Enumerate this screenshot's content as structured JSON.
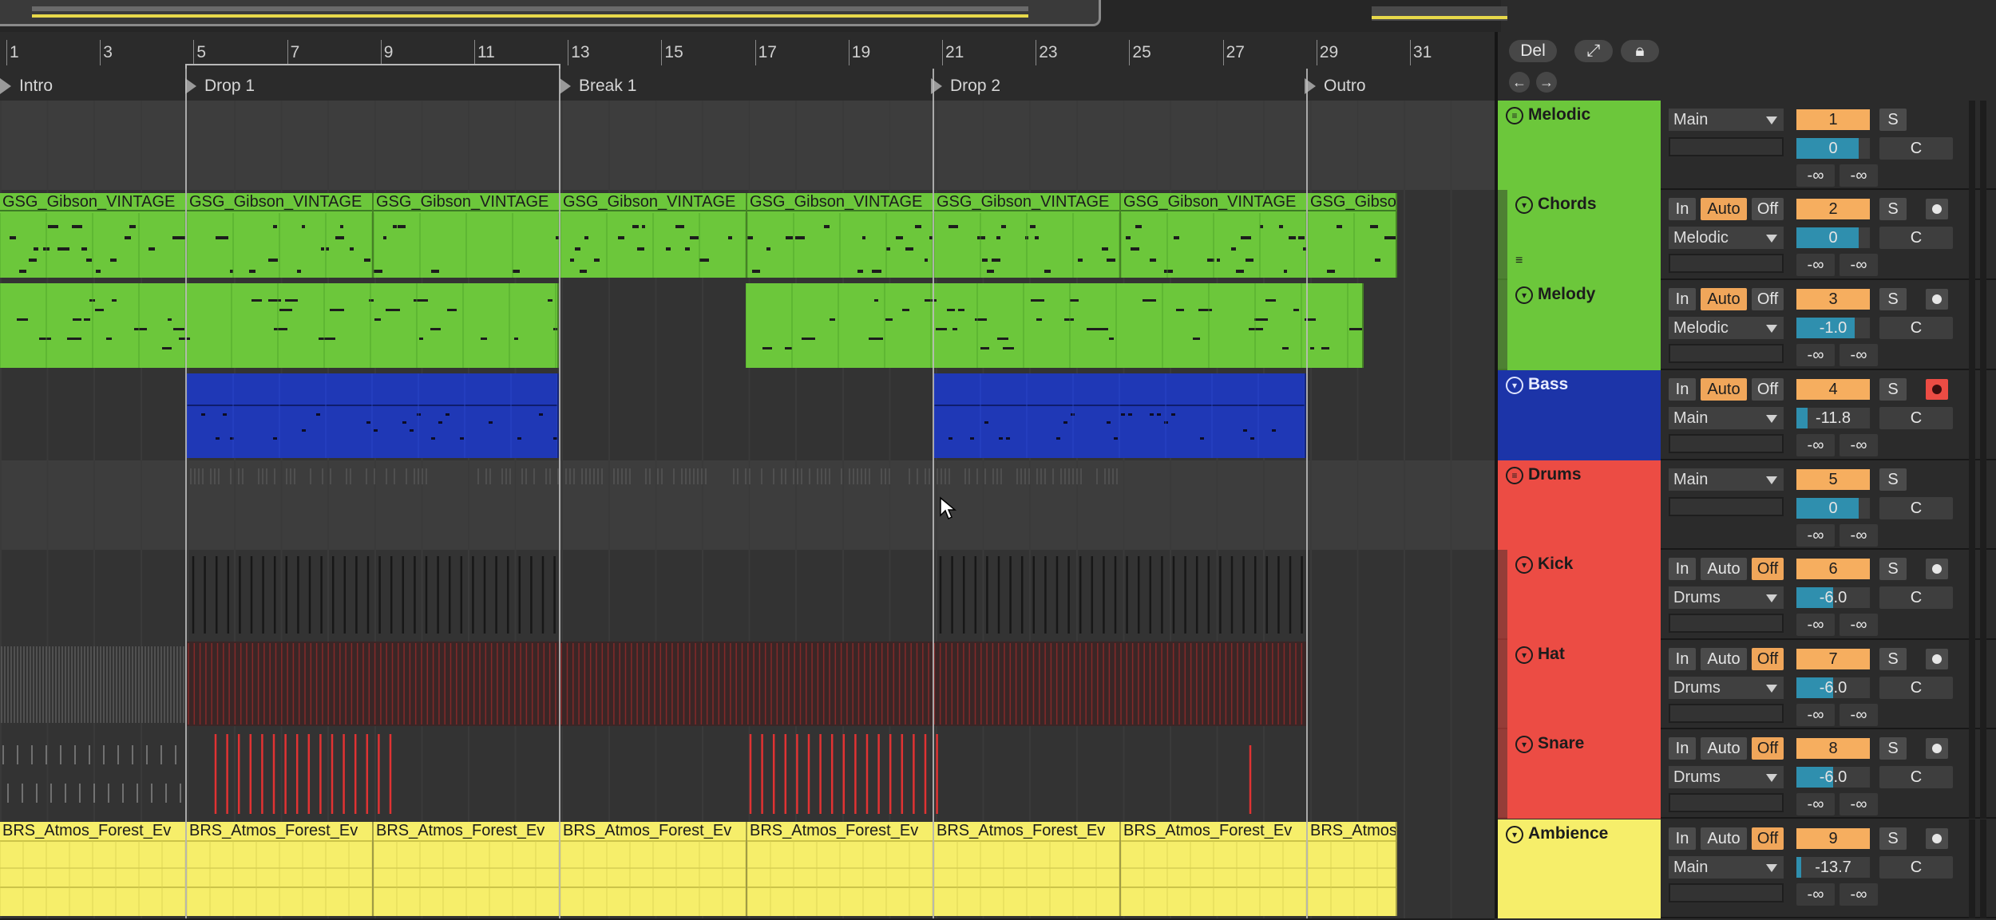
{
  "ruler": {
    "bars": [
      "1",
      "3",
      "5",
      "7",
      "9",
      "11",
      "13",
      "15",
      "17",
      "19",
      "21",
      "23",
      "25",
      "27",
      "29",
      "31"
    ]
  },
  "locators": [
    "Intro",
    "Drop 1",
    "Break 1",
    "Drop 2",
    "Outro"
  ],
  "clips": {
    "melodic_name": "GSG_Gibson_VINTAGE",
    "melodic_last": "GSG_Gibso",
    "ambience_name": "BRS_Atmos_Forest_Ev",
    "ambience_last": "BRS_Atmos"
  },
  "header": {
    "del_label": "Del",
    "expand_icon": "expand-icon",
    "lock_icon": "lock-icon",
    "back_icon": "arrow-left-icon",
    "forward_icon": "arrow-right-icon"
  },
  "tracks": [
    {
      "name": "Melodic",
      "color": "#6cc73b",
      "group": true,
      "routing": "Main",
      "number": "1",
      "solo": "S",
      "volume": "0",
      "pan": "C",
      "send_a": "-∞",
      "send_b": "-∞"
    },
    {
      "name": "Chords",
      "color": "#6cc73b",
      "in": "In",
      "auto": "Auto",
      "off": "Off",
      "routing": "Melodic",
      "number": "2",
      "solo": "S",
      "volume": "0",
      "pan": "C",
      "send_a": "-∞",
      "send_b": "-∞"
    },
    {
      "name": "Melody",
      "color": "#6cc73b",
      "in": "In",
      "auto": "Auto",
      "off": "Off",
      "routing": "Melodic",
      "number": "3",
      "solo": "S",
      "volume": "-1.0",
      "pan": "C",
      "send_a": "-∞",
      "send_b": "-∞"
    },
    {
      "name": "Bass",
      "color": "#1c34a8",
      "in": "In",
      "auto": "Auto",
      "off": "Off",
      "routing": "Main",
      "number": "4",
      "solo": "S",
      "volume": "-11.8",
      "pan": "C",
      "send_a": "-∞",
      "send_b": "-∞"
    },
    {
      "name": "Drums",
      "color": "#ec4c44",
      "group": true,
      "routing": "Main",
      "number": "5",
      "solo": "S",
      "volume": "0",
      "pan": "C",
      "send_a": "-∞",
      "send_b": "-∞"
    },
    {
      "name": "Kick",
      "color": "#ec4c44",
      "in": "In",
      "auto": "Auto",
      "off": "Off",
      "routing": "Drums",
      "number": "6",
      "solo": "S",
      "volume": "-6.0",
      "pan": "C",
      "send_a": "-∞",
      "send_b": "-∞"
    },
    {
      "name": "Hat",
      "color": "#ec4c44",
      "in": "In",
      "auto": "Auto",
      "off": "Off",
      "routing": "Drums",
      "number": "7",
      "solo": "S",
      "volume": "-6.0",
      "pan": "C",
      "send_a": "-∞",
      "send_b": "-∞"
    },
    {
      "name": "Snare",
      "color": "#ec4c44",
      "in": "In",
      "auto": "Auto",
      "off": "Off",
      "routing": "Drums",
      "number": "8",
      "solo": "S",
      "volume": "-6.0",
      "pan": "C",
      "send_a": "-∞",
      "send_b": "-∞"
    },
    {
      "name": "Ambience",
      "color": "#f6ee6a",
      "in": "In",
      "auto": "Auto",
      "off": "Off",
      "routing": "Main",
      "number": "9",
      "solo": "S",
      "volume": "-13.7",
      "pan": "C",
      "send_a": "-∞",
      "send_b": "-∞"
    }
  ]
}
